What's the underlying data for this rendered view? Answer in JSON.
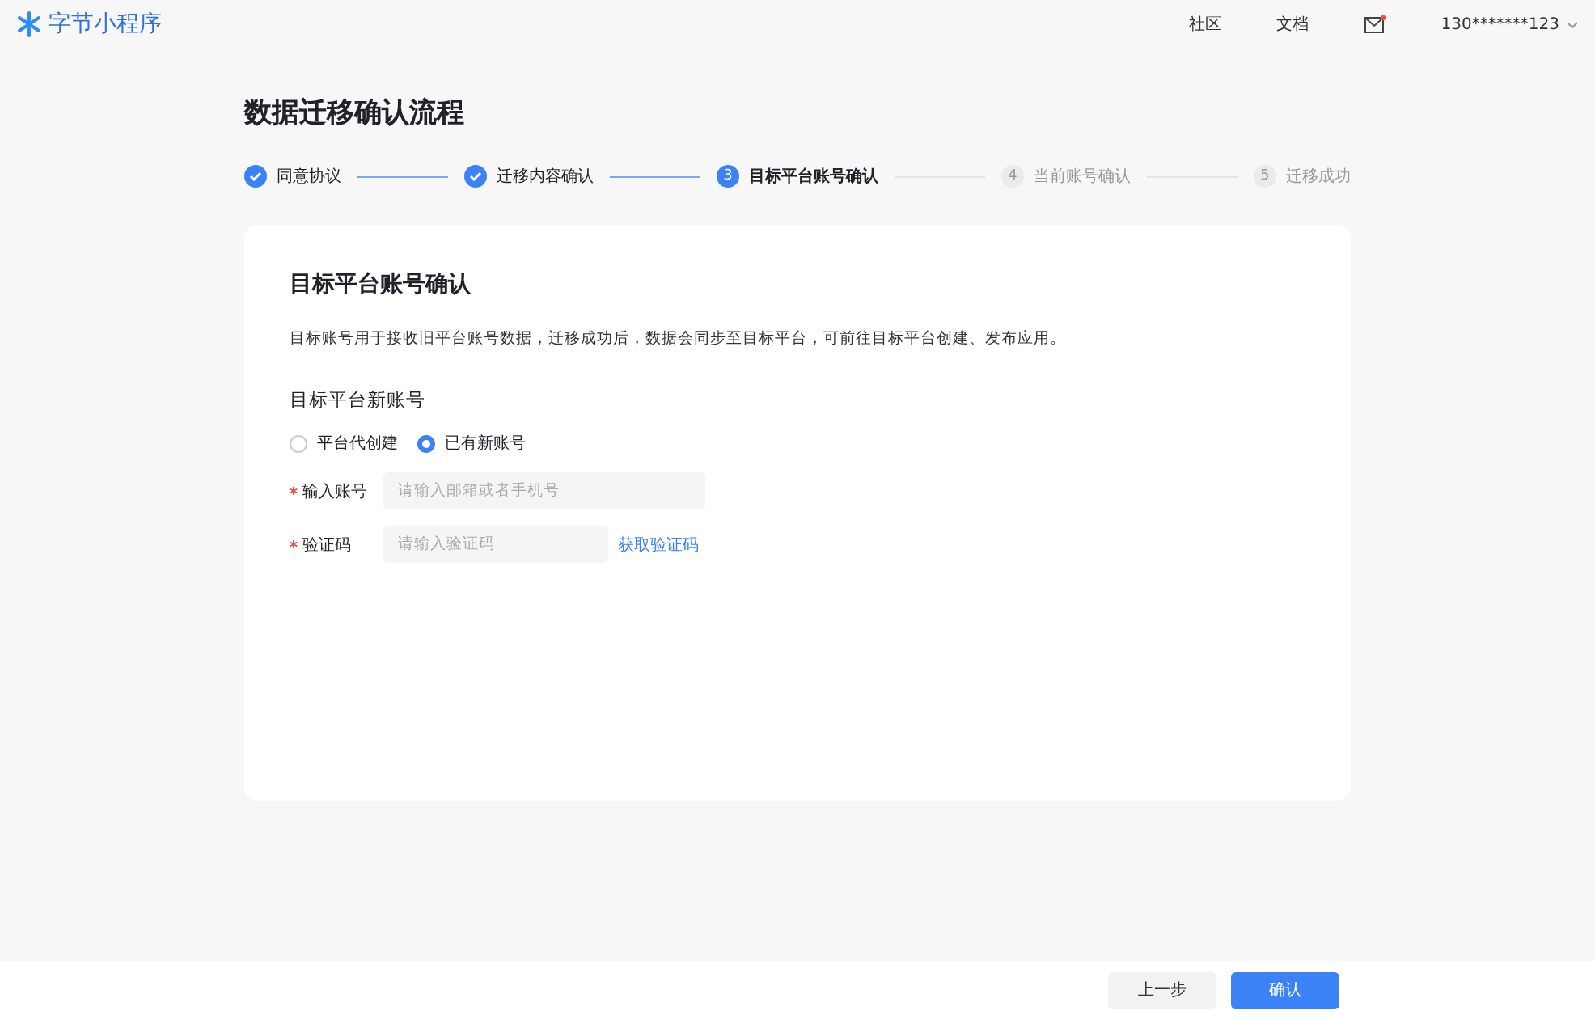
{
  "header": {
    "brand": "字节小程序",
    "links": [
      "社区",
      "文档"
    ],
    "mail_unread": true,
    "account": "130*******123"
  },
  "title": "数据迁移确认流程",
  "steps": [
    {
      "label": "同意协议",
      "kind": "done"
    },
    {
      "label": "迁移内容确认",
      "kind": "done"
    },
    {
      "number": "3",
      "label": "目标平台账号确认",
      "kind": "current"
    },
    {
      "number": "4",
      "label": "当前账号确认",
      "kind": "todo"
    },
    {
      "number": "5",
      "label": "迁移成功",
      "kind": "todo"
    }
  ],
  "card": {
    "title": "目标平台账号确认",
    "description": "目标账号用于接收旧平台账号数据，迁移成功后，数据会同步至目标平台，可前往目标平台创建、发布应用。",
    "section": "目标平台新账号",
    "options": [
      {
        "label": "平台代创建",
        "selected": false
      },
      {
        "label": "已有新账号",
        "selected": true
      }
    ],
    "fields": [
      {
        "label": "输入账号",
        "required": true,
        "placeholder": "请输入邮箱或者手机号"
      },
      {
        "label": "验证码",
        "required": true,
        "placeholder": "请输入验证码",
        "action": "获取验证码"
      }
    ]
  },
  "buttons": [
    {
      "label": "上一步",
      "kind": "secondary"
    },
    {
      "label": "确认",
      "kind": "primary"
    }
  ]
}
